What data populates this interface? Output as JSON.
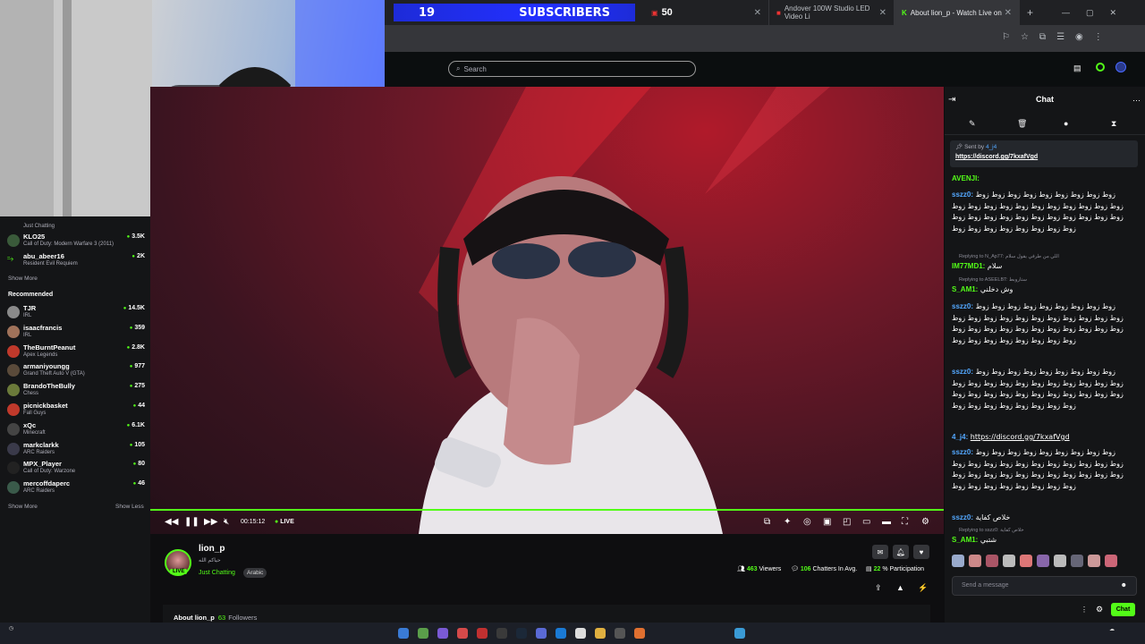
{
  "browser": {
    "tabs": [
      {
        "label": "Andover 100W Studio LED Video Li",
        "active": false
      },
      {
        "label": "About lion_p - Watch Live on",
        "active": true
      }
    ],
    "overlay_counters": {
      "subscribers_count": "19",
      "subscribers_label": "SUBSCRIBERS",
      "second_count": "50"
    },
    "new_tab": "+"
  },
  "header": {
    "search_placeholder": "Search"
  },
  "sidebar": {
    "following": [
      {
        "name": "KLO25",
        "category": "Call of Duty: Modern Warfare 3 (2011)",
        "viewers": "3.5K"
      },
      {
        "name": "abu_abeer16",
        "category": "Resident Evil Requiem",
        "viewers": "2K"
      }
    ],
    "show_more_top": "Show More",
    "recommended_title": "Recommended",
    "recommended": [
      {
        "name": "TJR",
        "category": "IRL",
        "viewers": "14.5K",
        "color": "#8a8a8a"
      },
      {
        "name": "isaacfrancis",
        "category": "IRL",
        "viewers": "359",
        "color": "#a0725a"
      },
      {
        "name": "TheBurntPeanut",
        "category": "Apex Legends",
        "viewers": "2.8K",
        "color": "#c0392b"
      },
      {
        "name": "armaniyoungg",
        "category": "Grand Theft Auto V (GTA)",
        "viewers": "977",
        "color": "#5a4a3a"
      },
      {
        "name": "BrandoTheBully",
        "category": "Chess",
        "viewers": "275",
        "color": "#6b7a3a"
      },
      {
        "name": "picnickbasket",
        "category": "Fall Guys",
        "viewers": "44",
        "color": "#c0392b"
      },
      {
        "name": "xQc",
        "category": "Minecraft",
        "viewers": "6.1K",
        "color": "#444444"
      },
      {
        "name": "markclarkk",
        "category": "ARC Raiders",
        "viewers": "105",
        "color": "#3a3a4a"
      },
      {
        "name": "MPX_Player",
        "category": "Call of Duty: Warzone",
        "viewers": "80",
        "color": "#222222"
      },
      {
        "name": "mercoffdaperc",
        "category": "ARC Raiders",
        "viewers": "46",
        "color": "#3a5a4a"
      }
    ],
    "show_more_bottom": "Show More",
    "show_less": "Show Less"
  },
  "player": {
    "time": "00:15:12",
    "live_label": "LIVE",
    "progress_percent": 100
  },
  "channel": {
    "name": "lion_p",
    "subtitle": "حياكم الله",
    "category": "Just Chatting",
    "tag": "Arabic",
    "live_badge": "LIVE",
    "viewers": "463",
    "viewers_label": "Viewers",
    "chatters": "106",
    "chatters_label": "Chatters In Avg.",
    "participation": "22",
    "participation_label": "% Participation",
    "about_label": "About lion_p",
    "followers": "63",
    "followers_label": "Followers"
  },
  "chat": {
    "title": "Chat",
    "pinned_by": "Sent by",
    "pinned_user": "4_j4",
    "pinned_link": "https://discord.gg/7kxafVgd",
    "messages": [
      {
        "user": "AVENJI:",
        "text": ""
      },
      {
        "user": "sszz0:",
        "text": "زوط زوط زوط زوط زوط زوط زوط زوط زوط زوط زوط زوط زوط زوط زوط زوط زوط زوط زوط زوط زوط زوط زوط زوط زوط زوط زوط زوط زوط زوط زوط زوط زوط زوط زوط زوط زوط زوط زوط"
      },
      {
        "reply": "Replying to N_Ap77: اللي من طرفي يقول سلام",
        "user": "IM77MD1:",
        "text": "سلام"
      },
      {
        "reply": "Replying to ASEELBT: ستاروبط",
        "user": "S_AM1:",
        "text": "وش دخلني"
      },
      {
        "user": "sszz0:",
        "text": "زوط زوط زوط زوط زوط زوط زوط زوط زوط زوط زوط زوط زوط زوط زوط زوط زوط زوط زوط زوط زوط زوط زوط زوط زوط زوط زوط زوط زوط زوط زوط زوط زوط زوط زوط زوط زوط زوط زوط"
      },
      {
        "user": "sszz0:",
        "text": "زوط زوط زوط زوط زوط زوط زوط زوط زوط زوط زوط زوط زوط زوط زوط زوط زوط زوط زوط زوط زوط زوط زوط زوط زوط زوط زوط زوط زوط زوط زوط زوط زوط زوط زوط زوط زوط زوط زوط"
      },
      {
        "user": "4_j4:",
        "text": "https://discord.gg/7kxafVgd"
      },
      {
        "user": "sszz0:",
        "text": "زوط زوط زوط زوط زوط زوط زوط زوط زوط زوط زوط زوط زوط زوط زوط زوط زوط زوط زوط زوط زوط زوط زوط زوط زوط زوط زوط زوط زوط زوط زوط زوط زوط زوط زوط زوط زوط زوط زوط"
      },
      {
        "user": "sszz0:",
        "text": "خلاص كفاية"
      },
      {
        "reply": "Replying to sszz0: خلاص كفاية",
        "user": "S_AM1:",
        "text": "شتبي"
      }
    ],
    "input_placeholder": "Send a message",
    "send_label": "Chat"
  },
  "colors": {
    "accent": "#53fc18",
    "background": "#0e0e10",
    "panel": "#141517"
  }
}
